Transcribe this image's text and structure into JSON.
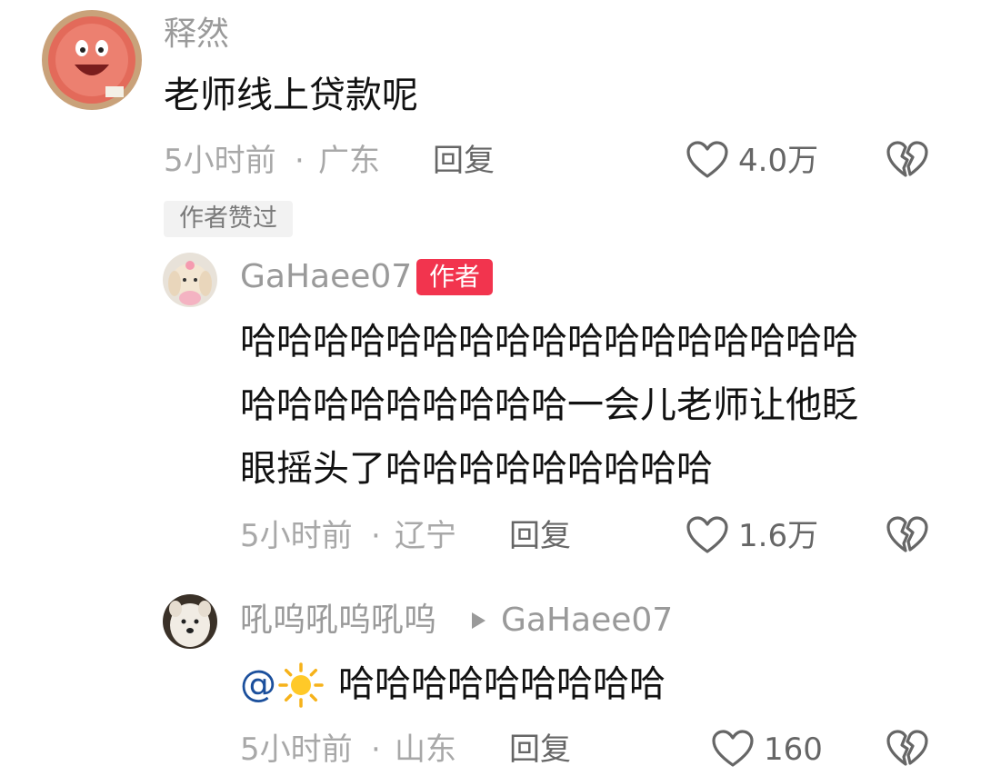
{
  "comments": [
    {
      "username": "释然",
      "text": "老师线上贷款呢",
      "time": "5小时前",
      "location": "广东",
      "reply_label": "回复",
      "likes": "4.0万",
      "badge": "作者赞过"
    },
    {
      "username": "GaHaee07",
      "author_tag": "作者",
      "text_lines": [
        "哈哈哈哈哈哈哈哈哈哈哈哈哈哈哈哈哈",
        "哈哈哈哈哈哈哈哈哈一会儿老师让他眨",
        "眼摇头了哈哈哈哈哈哈哈哈哈"
      ],
      "time": "5小时前",
      "location": "辽宁",
      "reply_label": "回复",
      "likes": "1.6万"
    },
    {
      "username": "吼呜吼呜吼呜",
      "reply_to": "GaHaee07",
      "mention": "@",
      "text": "哈哈哈哈哈哈哈哈哈",
      "time": "5小时前",
      "location": "山东",
      "reply_label": "回复",
      "likes": "160"
    }
  ],
  "separator": "·",
  "icons": {
    "like": "heart-outline-icon",
    "dislike": "broken-heart-icon",
    "reply_arrow": "triangle-right-icon",
    "sun": "sun-emoji-icon"
  },
  "colors": {
    "author_tag_bg": "#f2344e",
    "mention": "#1b4f9c",
    "username": "#9a9a9a",
    "meta": "#a8a8a8"
  }
}
